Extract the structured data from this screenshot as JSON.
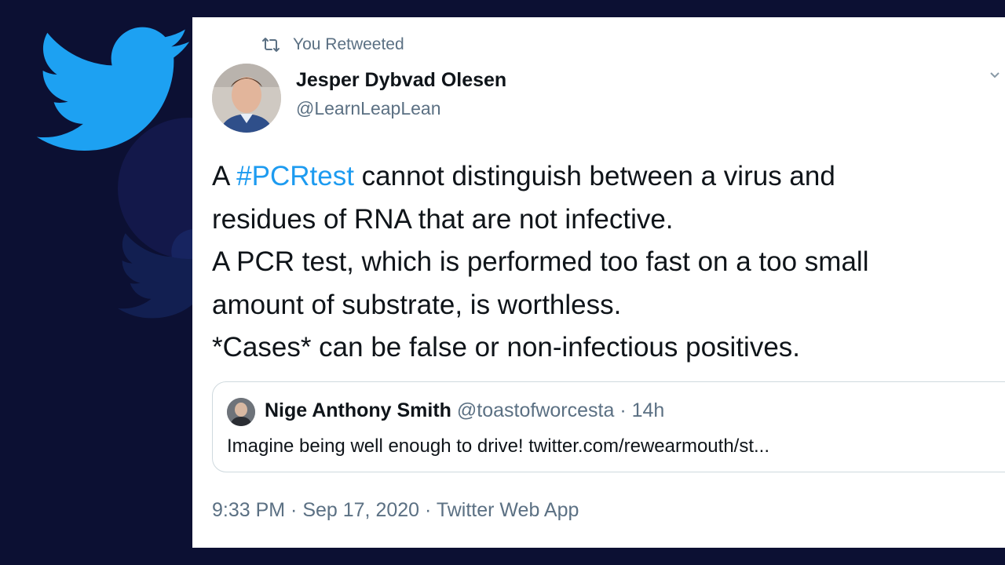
{
  "colors": {
    "background": "#0c1033",
    "twitter_blue": "#1da1f2",
    "hashtag_blue": "#1d9bf0",
    "secondary_text": "#5b7083",
    "primary_text": "#0f1419"
  },
  "icons": {
    "logo": "twitter-bird-icon",
    "retweet": "retweet-icon",
    "menu": "chevron-down-icon"
  },
  "retweet_label": "You Retweeted",
  "author": {
    "name": "Jesper Dybvad Olesen",
    "handle": "@LearnLeapLean"
  },
  "tweet": {
    "line1_prefix": "A ",
    "hashtag": "#PCRtest",
    "line1_suffix": " cannot distinguish between a virus and",
    "line2": "residues of RNA that are not infective.",
    "line3": "A PCR test, which is performed too fast on a too small",
    "line4": "amount of substrate, is worthless.",
    "line5": "*Cases* can be false or non-infectious positives."
  },
  "quoted_tweet": {
    "name": "Nige Anthony Smith",
    "meta": "@toastofworcesta · 14h",
    "text": "Imagine being well enough to drive! twitter.com/rewearmouth/st..."
  },
  "footer": {
    "timestamp": "9:33 PM · Sep 17, 2020 · Twitter Web App"
  }
}
